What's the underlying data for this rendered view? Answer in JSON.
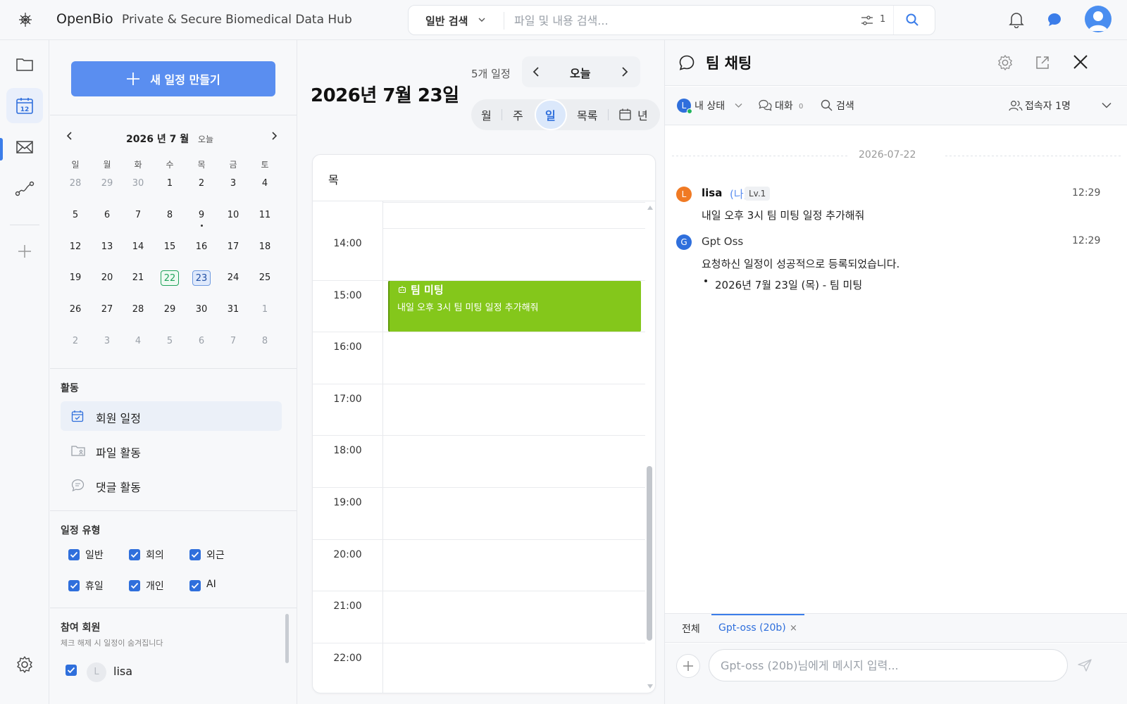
{
  "header": {
    "app_name": "OpenBio",
    "subtitle": "Private & Secure Biomedical Data Hub",
    "search_mode": "일반 검색",
    "search_placeholder": "파일 및 내용 검색...",
    "filter_count": "1"
  },
  "sidebar": {
    "new_event_label": "새 일정 만들기",
    "mini_calendar": {
      "title": "2026 년 7 월",
      "today_label": "오늘",
      "weekdays": [
        "일",
        "월",
        "화",
        "수",
        "목",
        "금",
        "토"
      ],
      "weeks": [
        [
          "28",
          "29",
          "30",
          "1",
          "2",
          "3",
          "4"
        ],
        [
          "5",
          "6",
          "7",
          "8",
          "9",
          "10",
          "11"
        ],
        [
          "12",
          "13",
          "14",
          "15",
          "16",
          "17",
          "18"
        ],
        [
          "19",
          "20",
          "21",
          "22",
          "23",
          "24",
          "25"
        ],
        [
          "26",
          "27",
          "28",
          "29",
          "30",
          "31",
          "1"
        ],
        [
          "2",
          "3",
          "4",
          "5",
          "6",
          "7",
          "8"
        ]
      ],
      "today": "22",
      "selected": "23"
    },
    "activity": {
      "title": "활동",
      "items": [
        "회원 일정",
        "파일 활동",
        "댓글 활동"
      ]
    },
    "event_types": {
      "title": "일정 유형",
      "items": [
        "일반",
        "회의",
        "외근",
        "휴일",
        "개인",
        "AI"
      ]
    },
    "members": {
      "title": "참여 회원",
      "note": "체크 해제 시 일정이 숨겨집니다",
      "list": [
        {
          "initial": "L",
          "name": "lisa"
        }
      ]
    }
  },
  "day_view": {
    "date_title": "2026년 7월 23일",
    "event_count": "5개 일정",
    "today_label": "오늘",
    "views": [
      "월",
      "주",
      "일",
      "목록",
      "년"
    ],
    "active_view": "일",
    "day_header": "목",
    "hours": [
      "14:00",
      "15:00",
      "16:00",
      "17:00",
      "18:00",
      "19:00",
      "20:00",
      "21:00",
      "22:00"
    ],
    "event": {
      "title": "팀 미팅",
      "description": "내일 오후 3시 팀 미팅 일정 추가해줘",
      "color": "#84c71b"
    }
  },
  "chat": {
    "title": "팀 채팅",
    "status_initial": "L",
    "my_status": "내 상태",
    "conversations_label": "대화",
    "conversations_count": "0",
    "search_label": "검색",
    "viewers_label": "접속자 1명",
    "date_separator": "2026-07-22",
    "messages": [
      {
        "initial": "L",
        "name": "lisa",
        "me": "(나)",
        "level": "Lv.1",
        "time": "12:29",
        "text": "내일 오후 3시 팀 미팅 일정 추가해줘"
      },
      {
        "initial": "G",
        "name": "Gpt Oss",
        "time": "12:29",
        "text": "요청하신 일정이 성공적으로 등록되었습니다.",
        "item": "2026년 7월 23일 (목) - 팀 미팅"
      }
    ],
    "tabs": {
      "all": "전체",
      "active": "Gpt-oss (20b)",
      "close": "×"
    },
    "input_placeholder": "Gpt-oss (20b)님에게 메시지 입력..."
  },
  "colors": {
    "accent": "#5a8ef0",
    "event": "#84c71b",
    "today": "#20a35b"
  }
}
